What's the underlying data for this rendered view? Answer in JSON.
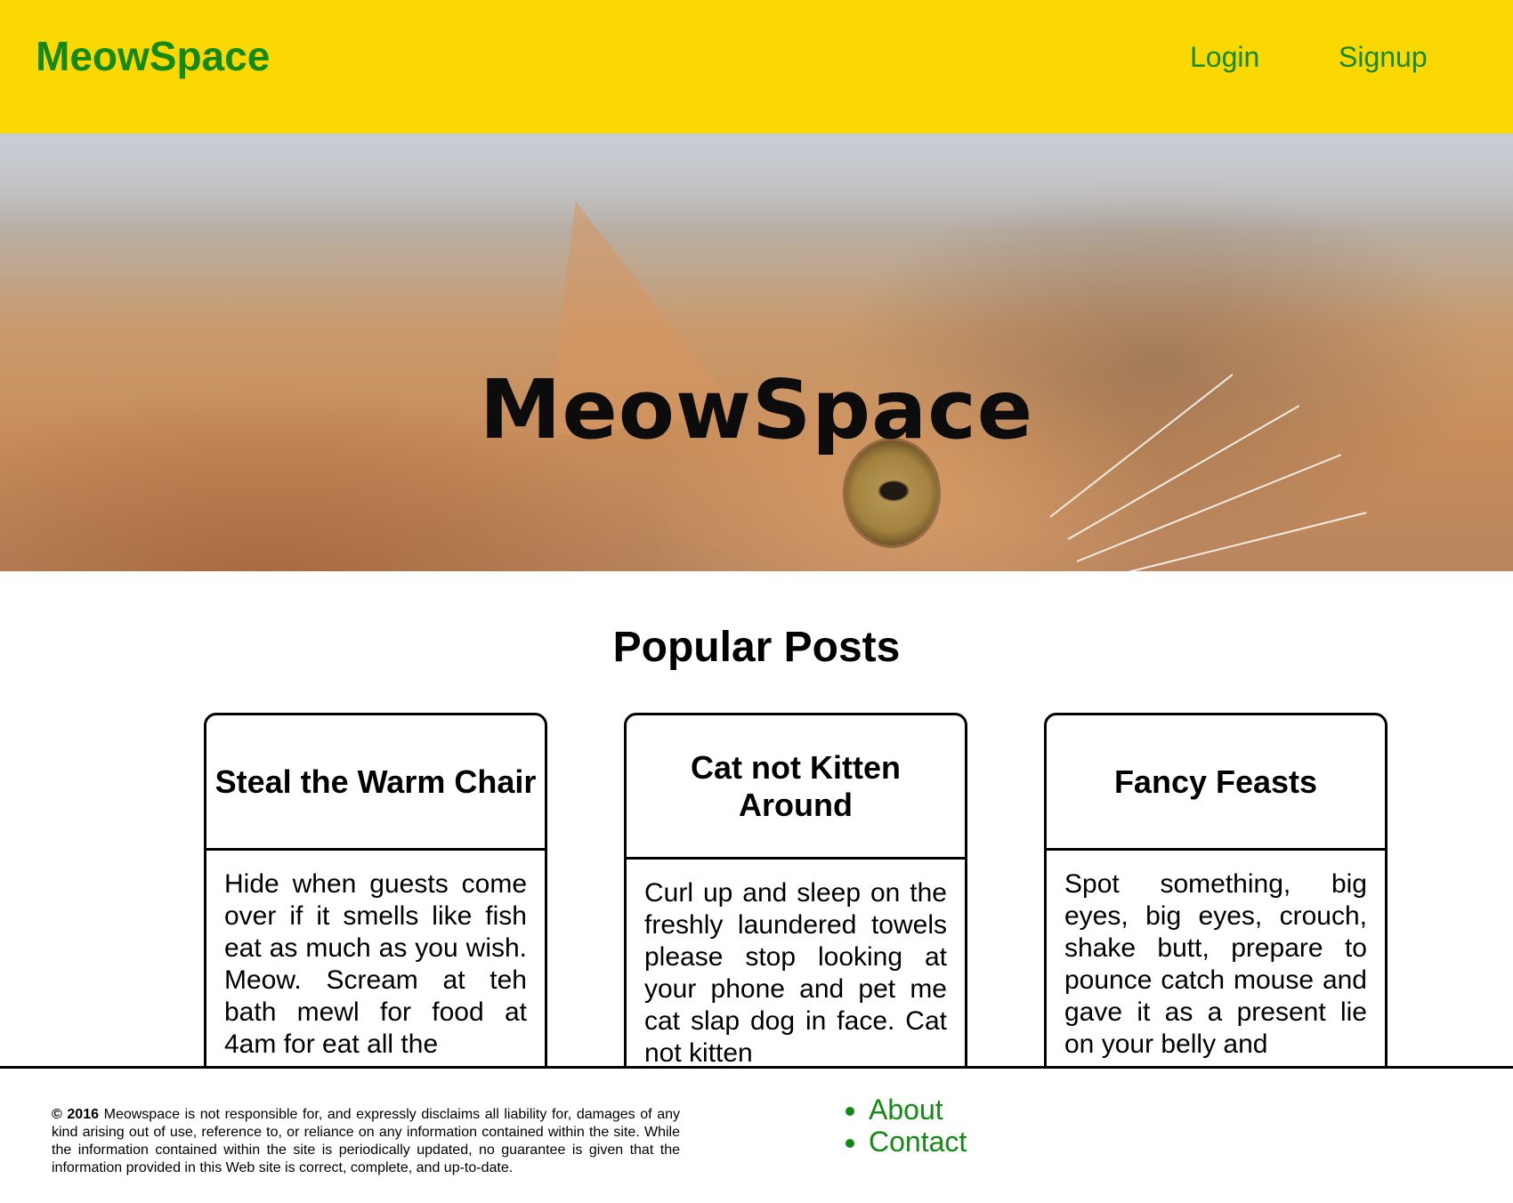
{
  "header": {
    "brand": "MeowSpace",
    "nav": [
      {
        "label": "Login"
      },
      {
        "label": "Signup"
      }
    ],
    "colors": {
      "background": "#fcd803",
      "text": "#138a13"
    }
  },
  "hero": {
    "title": "MeowSpace"
  },
  "popular": {
    "title": "Popular Posts",
    "posts": [
      {
        "title": "Steal the Warm Chair",
        "body": "Hide when guests come over if it smells like fish eat as much as you wish. Meow. Scream at teh bath mewl for food at 4am for eat all the"
      },
      {
        "title": "Cat not Kitten Around",
        "body": "Curl up and sleep on the freshly laundered towels please stop looking at your phone and pet me cat slap dog in face. Cat not kitten"
      },
      {
        "title": "Fancy Feasts",
        "body": "Spot something, big eyes, big eyes, crouch, shake butt, prepare to pounce catch mouse and gave it as a present lie on your belly and"
      }
    ]
  },
  "footer": {
    "copyright_year": "© 2016",
    "disclaimer": "Meowspace is not responsible for, and expressly disclaims all liability for, damages of any kind arising out of use, reference to, or reliance on any information contained within the site. While the information contained within the site is periodically updated, no guarantee is given that the information provided in this Web site is correct, complete, and up-to-date.",
    "links": [
      {
        "label": "About"
      },
      {
        "label": "Contact"
      }
    ]
  }
}
